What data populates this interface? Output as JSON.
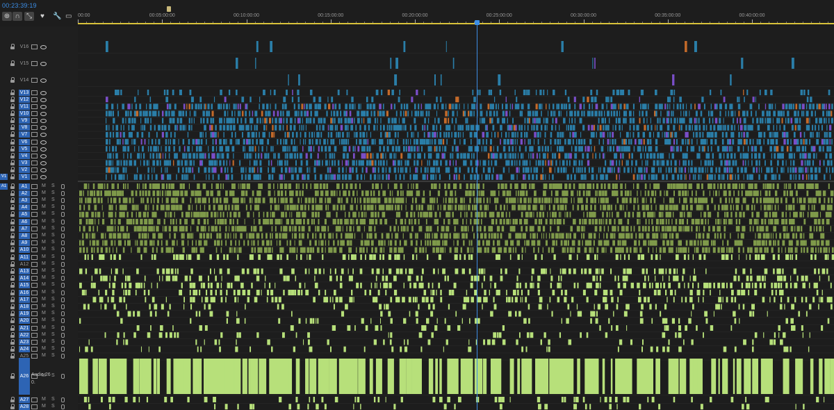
{
  "timecode": "00:23:39:19",
  "toolbar": [
    {
      "name": "insert-overwrite-icon",
      "glyph": "⊕"
    },
    {
      "name": "snap-magnet-icon",
      "glyph": "∩"
    },
    {
      "name": "linked-selection-icon",
      "glyph": "⤡"
    },
    {
      "name": "add-marker-icon",
      "glyph": "♥"
    },
    {
      "name": "wrench-icon",
      "glyph": "🔧"
    },
    {
      "name": "captions-icon",
      "glyph": "▭"
    }
  ],
  "ruler": {
    "labels": [
      "00:00",
      "00:05:00:00",
      "00:10:00:00",
      "00:15:00:00",
      "00:20:00:00",
      "00:25:00:00",
      "00:30:00:00",
      "00:35:00:00",
      "00:40:00:00"
    ],
    "total_minutes": 45,
    "playhead_minutes": 23.66
  },
  "source_patch": {
    "video": "V1",
    "audio": "A1"
  },
  "video_tracks": [
    "V16",
    "V15",
    "V14",
    "V13",
    "V12",
    "V11",
    "V10",
    "V9",
    "V8",
    "V7",
    "V6",
    "V5",
    "V4",
    "V3",
    "V2",
    "V1"
  ],
  "audio_tracks": [
    "A1",
    "A2",
    "A3",
    "A4",
    "A5",
    "A6",
    "A7",
    "A8",
    "A9",
    "A10",
    "A11",
    "A12",
    "A13",
    "A14",
    "A15",
    "A16",
    "A17",
    "A18",
    "A19",
    "A20",
    "A21",
    "A22",
    "A23",
    "A24",
    "A25",
    "A26",
    "A27",
    "A28"
  ],
  "audio_labels": {
    "mute": "M",
    "solo": "S"
  },
  "a26": {
    "name": "Audio 26",
    "volume": "0."
  },
  "colors": {
    "accent": "#3c8ee6",
    "video_clip": "#2a7ea8",
    "video_clip_alt": "#7a4ec8",
    "audio_clip": "#7f9a4a",
    "audio_clip_bright": "#b7e07a",
    "ruler_bar": "#d8c13a",
    "background": "#1d1d1d"
  }
}
